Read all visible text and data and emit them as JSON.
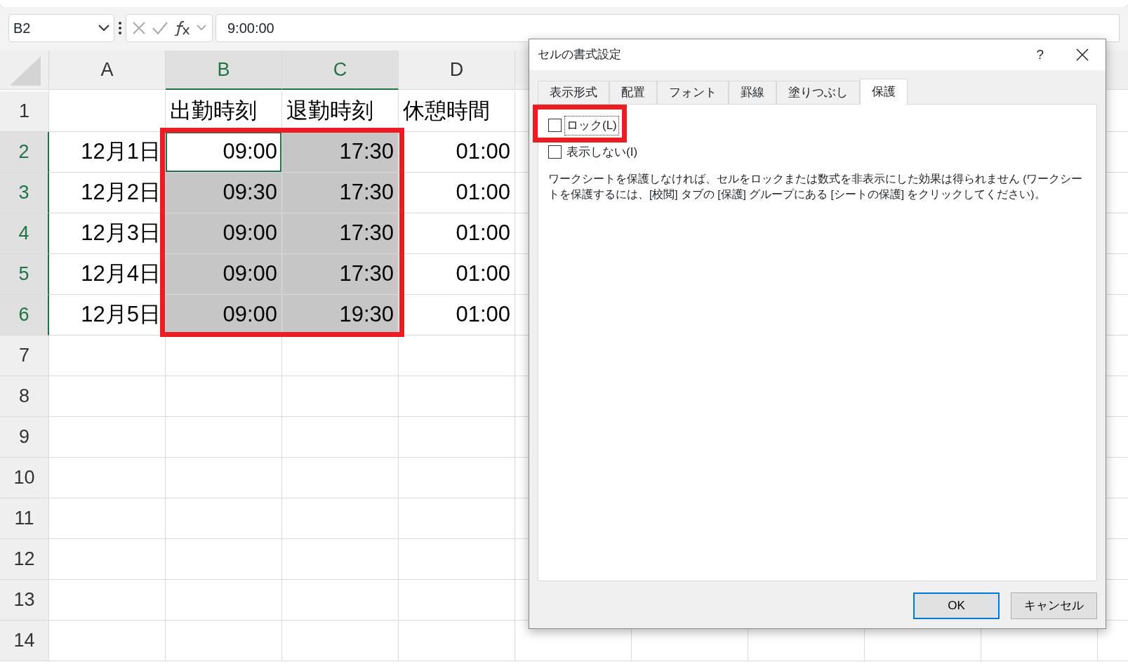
{
  "formula_bar": {
    "name_box": "B2",
    "formula": "9:00:00"
  },
  "sheet": {
    "columns": [
      {
        "label": "A",
        "selected": false
      },
      {
        "label": "B",
        "selected": true
      },
      {
        "label": "C",
        "selected": true
      },
      {
        "label": "D",
        "selected": false
      }
    ],
    "rows": [
      {
        "label": "1",
        "selected": false,
        "kind": "header",
        "cells": [
          {
            "text": "出勤時刻",
            "selected": false,
            "active": false
          },
          {
            "text": "退勤時刻",
            "selected": false,
            "active": false
          },
          {
            "text": "休憩時間",
            "selected": false,
            "active": false
          }
        ]
      },
      {
        "label": "2",
        "selected": true,
        "kind": "data",
        "cells": [
          {
            "text": "12月1日",
            "selected": false,
            "active": false
          },
          {
            "text": "09:00",
            "selected": true,
            "active": true
          },
          {
            "text": "17:30",
            "selected": true,
            "active": false
          },
          {
            "text": "01:00",
            "selected": false,
            "active": false
          }
        ]
      },
      {
        "label": "3",
        "selected": true,
        "kind": "data",
        "cells": [
          {
            "text": "12月2日",
            "selected": false,
            "active": false
          },
          {
            "text": "09:30",
            "selected": true,
            "active": false
          },
          {
            "text": "17:30",
            "selected": true,
            "active": false
          },
          {
            "text": "01:00",
            "selected": false,
            "active": false
          }
        ]
      },
      {
        "label": "4",
        "selected": true,
        "kind": "data",
        "cells": [
          {
            "text": "12月3日",
            "selected": false,
            "active": false
          },
          {
            "text": "09:00",
            "selected": true,
            "active": false
          },
          {
            "text": "17:30",
            "selected": true,
            "active": false
          },
          {
            "text": "01:00",
            "selected": false,
            "active": false
          }
        ]
      },
      {
        "label": "5",
        "selected": true,
        "kind": "data",
        "cells": [
          {
            "text": "12月4日",
            "selected": false,
            "active": false
          },
          {
            "text": "09:00",
            "selected": true,
            "active": false
          },
          {
            "text": "17:30",
            "selected": true,
            "active": false
          },
          {
            "text": "01:00",
            "selected": false,
            "active": false
          }
        ]
      },
      {
        "label": "6",
        "selected": true,
        "kind": "data",
        "cells": [
          {
            "text": "12月5日",
            "selected": false,
            "active": false
          },
          {
            "text": "09:00",
            "selected": true,
            "active": false
          },
          {
            "text": "19:30",
            "selected": true,
            "active": false
          },
          {
            "text": "01:00",
            "selected": false,
            "active": false
          }
        ]
      },
      {
        "label": "7",
        "selected": false
      },
      {
        "label": "8",
        "selected": false
      },
      {
        "label": "9",
        "selected": false
      },
      {
        "label": "10",
        "selected": false
      },
      {
        "label": "11",
        "selected": false
      },
      {
        "label": "12",
        "selected": false
      },
      {
        "label": "13",
        "selected": false
      },
      {
        "label": "14",
        "selected": false
      }
    ],
    "selection_highlighted": true
  },
  "dialog": {
    "title": "セルの書式設定",
    "help": "?",
    "tabs": [
      {
        "label": "表示形式",
        "selected": false
      },
      {
        "label": "配置",
        "selected": false
      },
      {
        "label": "フォント",
        "selected": false
      },
      {
        "label": "罫線",
        "selected": false
      },
      {
        "label": "塗りつぶし",
        "selected": false
      },
      {
        "label": "保護",
        "selected": true
      }
    ],
    "options": [
      {
        "label": "ロック(L)",
        "checked": false,
        "focused": true,
        "highlight": true
      },
      {
        "label": "表示しない(I)",
        "checked": false,
        "focused": false,
        "highlight": false
      }
    ],
    "note": "ワークシートを保護しなければ、セルをロックまたは数式を非表示にした効果は得られません (ワークシートを保護するには、[校閲] タブの [保護] グループにある [シートの保護] をクリックしてください)。",
    "buttons": [
      {
        "label": "OK",
        "default": true
      },
      {
        "label": "キャンセル",
        "default": false
      }
    ]
  }
}
